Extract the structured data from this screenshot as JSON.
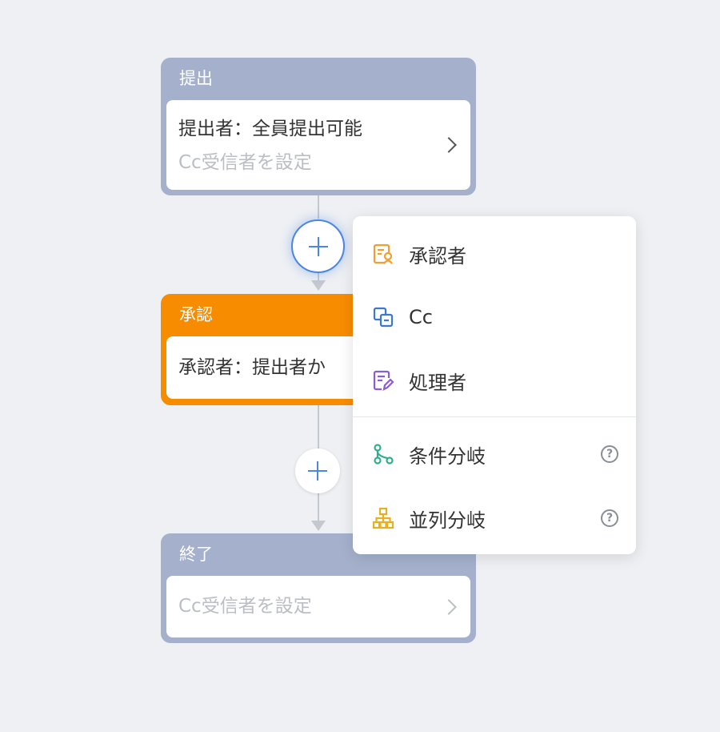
{
  "nodes": {
    "submit": {
      "title": "提出",
      "line1": "提出者：全員提出可能",
      "line2": "Cc受信者を設定"
    },
    "approve": {
      "title": "承認",
      "line1": "承認者：提出者か"
    },
    "end": {
      "title": "終了",
      "line2": "Cc受信者を設定"
    }
  },
  "menu": {
    "items": [
      {
        "label": "承認者",
        "icon": "approver-icon",
        "color": "#f0a030"
      },
      {
        "label": "Cc",
        "icon": "cc-icon",
        "color": "#3a78d4"
      },
      {
        "label": "処理者",
        "icon": "handler-icon",
        "color": "#8a5cd8"
      },
      {
        "label": "条件分岐",
        "icon": "condition-branch-icon",
        "color": "#2fae8e"
      },
      {
        "label": "並列分岐",
        "icon": "parallel-branch-icon",
        "color": "#e8b020"
      }
    ],
    "help_symbol": "?"
  },
  "colors": {
    "gray_node": "#a5b1cc",
    "orange_node": "#f88c00",
    "accent": "#4a86e8",
    "background": "#eef0f3"
  }
}
